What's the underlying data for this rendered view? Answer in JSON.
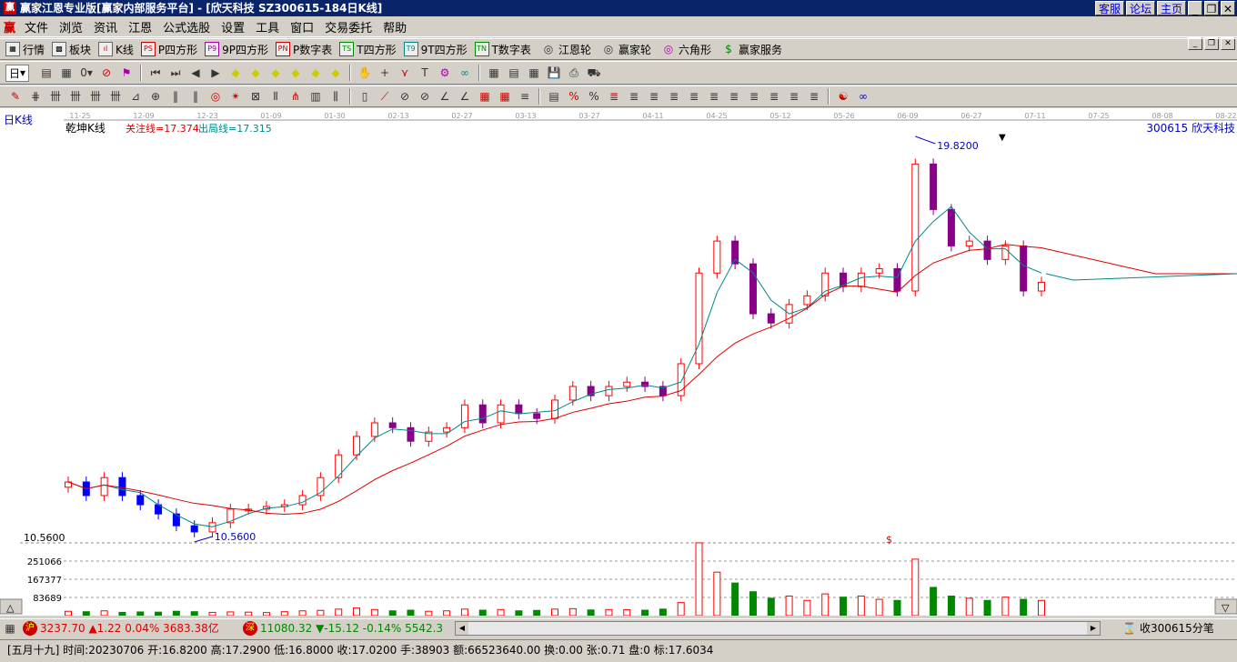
{
  "title": "赢家江恩专业版[赢家内部服务平台] - [欣天科技   SZ300615-184日K线]",
  "title_buttons": [
    "客服",
    "论坛",
    "主页"
  ],
  "menu": [
    "文件",
    "浏览",
    "资讯",
    "江恩",
    "公式选股",
    "设置",
    "工具",
    "窗口",
    "交易委托",
    "帮助"
  ],
  "menu_logo": "赢",
  "toolbar1": [
    {
      "icon": "PS",
      "label": "P四方形"
    },
    {
      "icon": "P9",
      "label": "9P四方形"
    },
    {
      "icon": "PN",
      "label": "P数字表"
    },
    {
      "icon": "TS",
      "label": "T四方形"
    },
    {
      "icon": "T9",
      "label": "9T四方形"
    },
    {
      "icon": "TN",
      "label": "T数字表"
    },
    {
      "icon": "◎",
      "label": "江恩轮"
    },
    {
      "icon": "◎",
      "label": "赢家轮"
    },
    {
      "icon": "◎",
      "label": "六角形"
    },
    {
      "icon": "$",
      "label": "赢家服务"
    }
  ],
  "toolbar1_first": [
    {
      "icon": "▦",
      "label": "行情"
    },
    {
      "icon": "▩",
      "label": "板块"
    },
    {
      "icon": "ıl",
      "label": "K线"
    }
  ],
  "period_select": "日",
  "chart": {
    "period_label": "日K线",
    "indicator": "乾坤K线",
    "attention_line": "关注线=17.374",
    "exit_line": "出局线=17.315",
    "stock": "300615 欣天科技",
    "high_label": "19.8200",
    "low_label": "10.5600",
    "axis_price": "10.5600",
    "volume_ticks": [
      "251066",
      "167377",
      "83689"
    ],
    "dates": [
      "11-25",
      "12-09",
      "12-23",
      "01-09",
      "01-30",
      "02-13",
      "02-27",
      "03-13",
      "03-27",
      "04-11",
      "04-25",
      "05-12",
      "05-26",
      "06-09",
      "06-27",
      "07-11",
      "07-25",
      "08-08",
      "08-22"
    ],
    "dollar_marker": "$"
  },
  "chart_data": {
    "type": "candlestick",
    "ylim": [
      10.56,
      19.82
    ],
    "closes": [
      11.93,
      11.62,
      12.03,
      11.62,
      11.41,
      11.2,
      10.93,
      10.79,
      11.0,
      11.31,
      11.31,
      11.37,
      11.41,
      11.62,
      12.03,
      12.55,
      12.97,
      13.28,
      13.17,
      12.86,
      13.07,
      13.17,
      13.69,
      13.28,
      13.69,
      13.49,
      13.38,
      13.8,
      14.11,
      13.9,
      14.11,
      14.21,
      14.11,
      13.9,
      14.63,
      16.7,
      17.43,
      16.91,
      15.77,
      15.56,
      15.98,
      16.18,
      16.7,
      16.39,
      16.7,
      16.8,
      16.29,
      19.19,
      18.15,
      17.32,
      17.43,
      17.01,
      17.32,
      16.29,
      16.49
    ],
    "volumes": [
      20000,
      18000,
      22000,
      15000,
      17000,
      16000,
      20000,
      18000,
      15000,
      17000,
      16000,
      14000,
      18000,
      22000,
      24000,
      30000,
      35000,
      28000,
      22000,
      25000,
      20000,
      22000,
      30000,
      25000,
      28000,
      22000,
      24000,
      30000,
      32000,
      26000,
      28000,
      27000,
      25000,
      30000,
      60000,
      335000,
      200000,
      150000,
      110000,
      80000,
      90000,
      70000,
      100000,
      85000,
      90000,
      75000,
      70000,
      260000,
      130000,
      90000,
      80000,
      70000,
      85000,
      75000,
      70000
    ]
  },
  "status": {
    "sh_badge": "沪",
    "sh": "3237.70 ▲1.22 0.04% 3683.38亿",
    "sz_badge": "深",
    "sz": "11080.32 ▼-15.12 -0.14% 5542.3",
    "right": "收300615分笔"
  },
  "info": "[五月十九] 时间:20230706 开:16.8200 高:17.2900 低:16.8000 收:17.0200 手:38903 额:66523640.00 换:0.00 张:0.71 盘:0 标:17.6034"
}
